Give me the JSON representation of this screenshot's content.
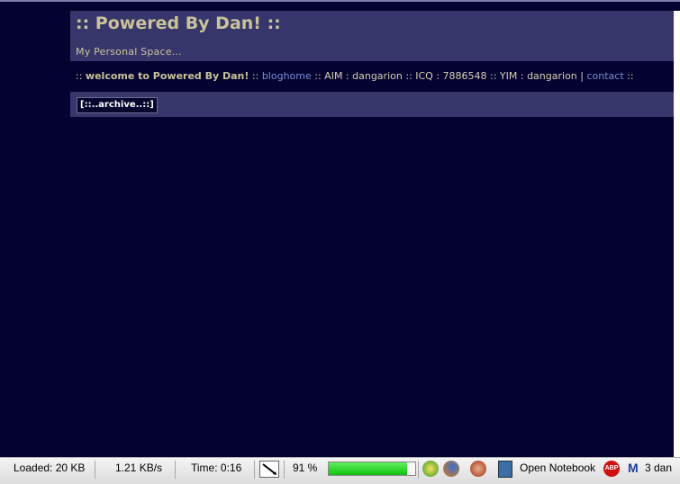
{
  "site": {
    "title": ":: Powered By Dan! ::",
    "subtitle": "My Personal Space..."
  },
  "nav": {
    "prefix": "::",
    "welcome": "welcome to Powered By Dan!",
    "sep1": "::",
    "bloghome": "bloghome",
    "aim": ":: AIM : dangarion :: ICQ : 7886548 :: YIM : dangarion |",
    "contact": "contact",
    "suffix": "::"
  },
  "archive": {
    "label": "[::..archive..::]"
  },
  "statusbar": {
    "loaded": "Loaded: 20 KB",
    "speed": "1.21 KB/s",
    "time": "Time: 0:16",
    "percent": "91 %",
    "progress": 0.91,
    "notebook": "Open Notebook",
    "abp": "ABP",
    "gmail_count": "3 dan",
    "gmail_letter": "M"
  }
}
